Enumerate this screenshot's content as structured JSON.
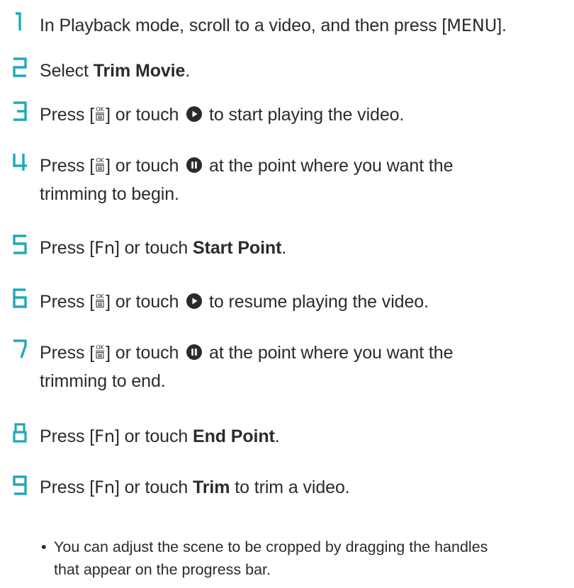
{
  "colors": {
    "step_number": "#21a9b7",
    "text": "#2b2b2b"
  },
  "icons": {
    "ok_key": "ok-menu-key-icon",
    "play": "play-icon",
    "pause": "pause-icon"
  },
  "steps": [
    {
      "number": "1",
      "prefix": "In Playback mode, scroll to a video, and then press [",
      "key": "MENU",
      "suffix": "]."
    },
    {
      "number": "2",
      "prefix": "Select ",
      "bold": "Trim Movie",
      "suffix": "."
    },
    {
      "number": "3",
      "prefix": "Press [",
      "mid": "] or touch ",
      "suffix": " to start playing the video."
    },
    {
      "number": "4",
      "prefix": "Press [",
      "mid": "] or touch ",
      "suffix": " at the point where you want the",
      "line2": "trimming to begin."
    },
    {
      "number": "5",
      "prefix": "Press [",
      "key": "Fn",
      "mid": "] or touch ",
      "bold": "Start Point",
      "suffix": "."
    },
    {
      "number": "6",
      "prefix": "Press [",
      "mid": "] or touch ",
      "suffix": " to resume playing the video."
    },
    {
      "number": "7",
      "prefix": "Press [",
      "mid": "] or touch ",
      "suffix": " at the point where you want the",
      "line2": "trimming to end."
    },
    {
      "number": "8",
      "prefix": "Press [",
      "key": "Fn",
      "mid": "] or touch ",
      "bold": "End Point",
      "suffix": "."
    },
    {
      "number": "9",
      "prefix": "Press [",
      "key": "Fn",
      "mid": "] or touch ",
      "bold": "Trim",
      "suffix": " to trim a video."
    }
  ],
  "note": {
    "bullet": "•",
    "line1": "You can adjust the scene to be cropped by dragging the handles",
    "line2": "that appear on the progress bar."
  }
}
